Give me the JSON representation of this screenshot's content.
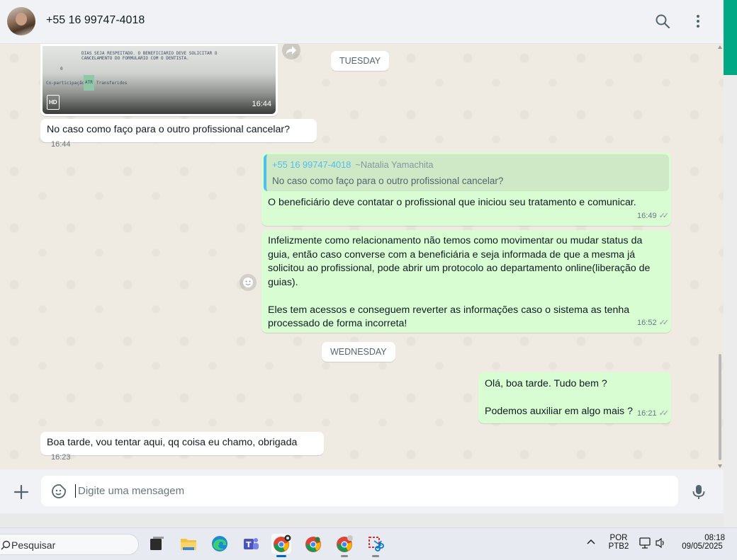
{
  "header": {
    "contact_name": "+55 16 99747-4018",
    "icons": [
      "search-icon",
      "menu-icon"
    ]
  },
  "image_message": {
    "doc_lines": [
      "DIAS SEJA RESPEITADO. O BENEFICIARIO DEVE SOLICITAR O",
      "CANCELAMENTO DO FORMULARIO COM O DENTISTA.",
      "0",
      "Co-participação",
      "ATR",
      "Transferidos"
    ],
    "hd_label": "HD",
    "time": "16:44"
  },
  "date_chips": {
    "tuesday": "TUESDAY",
    "wednesday": "WEDNESDAY"
  },
  "messages": [
    {
      "dir": "in",
      "text": "No caso como faço para o outro profissional cancelar?",
      "time": "16:44"
    },
    {
      "dir": "out",
      "quote_name": "+55 16 99747-4018",
      "quote_alias": "~Natalia Yamachita",
      "quote_text": "No caso como faço para o outro profissional cancelar?",
      "text": "O beneficiário deve contatar o profissional que iniciou seu tratamento e comunicar.",
      "time": "16:49"
    },
    {
      "dir": "out",
      "text_lines": [
        "Infelizmente como relacionamento não temos como movimentar ou mudar status da",
        "guia, então caso converse com a beneficiária e seja informada de que a mesma já",
        "solicitou ao profissional, pode abrir um protocolo ao departamento online(liberação de",
        "guias).",
        "",
        "Eles tem acessos e conseguem reverter as informações caso o sistema as tenha",
        "processado de forma incorreta!"
      ],
      "time": "16:52"
    },
    {
      "dir": "out",
      "text_lines": [
        "Olá, boa tarde. Tudo bem ?",
        "",
        "Podemos auxiliar em algo mais ?"
      ],
      "time": "16:21"
    },
    {
      "dir": "in",
      "text": "Boa tarde, vou tentar aqui, qq coisa eu chamo, obrigada",
      "time": "16:23"
    }
  ],
  "composer": {
    "placeholder": "Digite uma mensagem"
  },
  "taskbar": {
    "search_label": "Pesquisar",
    "apps": [
      "task-view-icon",
      "file-explorer-icon",
      "edge-icon",
      "teams-icon",
      "chrome-icon",
      "chrome-icon",
      "chrome-icon",
      "snipping-tool-icon"
    ],
    "language_line1": "POR",
    "language_line2": "PTB2",
    "clock_time": "08:18",
    "clock_date": "09/05/2025"
  },
  "colors": {
    "outgoing_bubble": "#d9fdd3",
    "incoming_bubble": "#ffffff",
    "chat_bg": "#efeae2",
    "accent_green": "#00a884",
    "quote_name": "#53bdeb"
  }
}
